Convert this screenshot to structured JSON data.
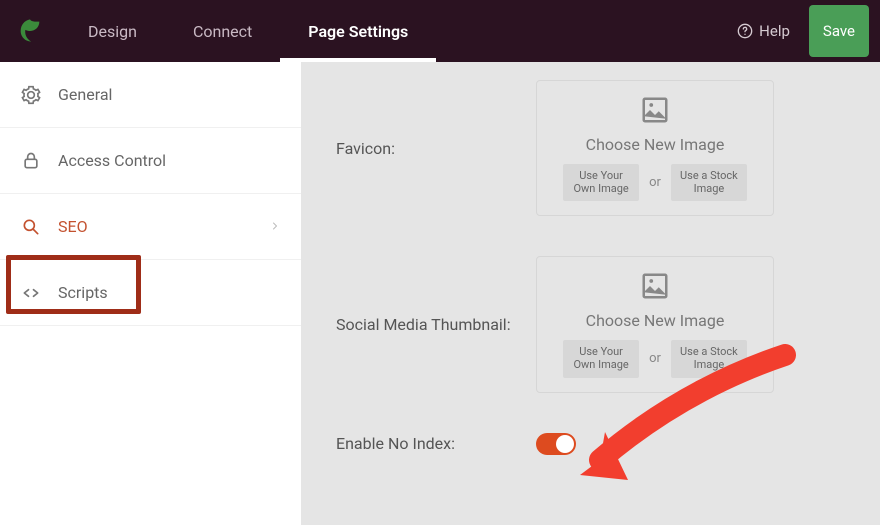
{
  "topbar": {
    "tabs": [
      "Design",
      "Connect",
      "Page Settings"
    ],
    "active_tab": 2,
    "help_label": "Help",
    "save_label": "Save"
  },
  "sidebar": {
    "items": [
      {
        "label": "General"
      },
      {
        "label": "Access Control"
      },
      {
        "label": "SEO",
        "active": true
      },
      {
        "label": "Scripts"
      }
    ]
  },
  "main": {
    "favicon": {
      "label": "Favicon:",
      "choose": "Choose New Image",
      "own_btn": "Use Your Own Image",
      "stock_btn": "Use a Stock Image",
      "or": "or"
    },
    "social": {
      "label": "Social Media Thumbnail:",
      "choose": "Choose New Image",
      "own_btn": "Use Your Own Image",
      "stock_btn": "Use a Stock Image",
      "or": "or"
    },
    "noindex": {
      "label": "Enable No Index:",
      "on": true
    }
  }
}
